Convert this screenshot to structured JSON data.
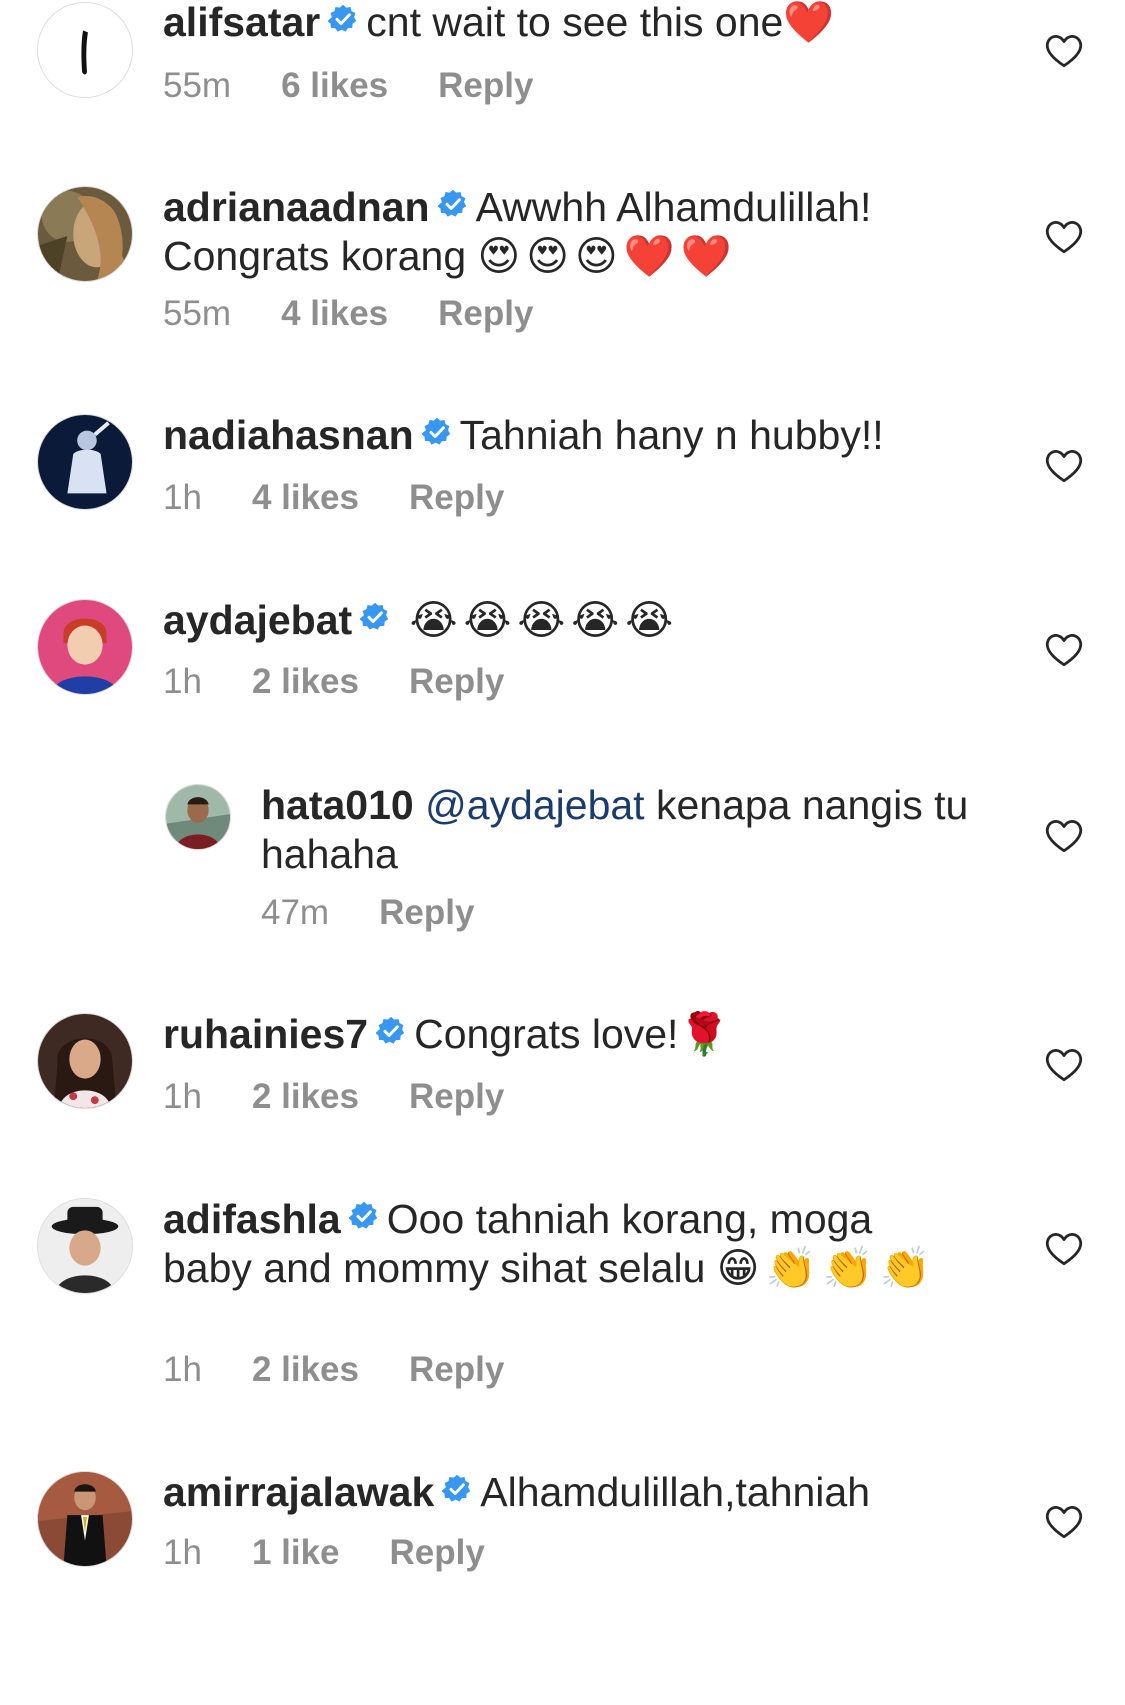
{
  "comments": [
    {
      "username": "alifsatar",
      "text": "cnt wait to see this one",
      "emoji": "❤️",
      "time": "55m",
      "likes": "6 likes",
      "reply": "Reply"
    },
    {
      "username": "adrianaadnan",
      "text": "Awwhh Alhamdulillah! Congrats korang",
      "emoji": "😍😍😍❤️❤️",
      "time": "55m",
      "likes": "4 likes",
      "reply": "Reply"
    },
    {
      "username": "nadiahasnan",
      "text": "Tahniah hany n hubby!!",
      "emoji": "",
      "time": "1h",
      "likes": "4 likes",
      "reply": "Reply"
    },
    {
      "username": "aydajebat",
      "text": "",
      "emoji": "😭😭😭😭😭",
      "time": "1h",
      "likes": "2 likes",
      "reply": "Reply"
    },
    {
      "username": "hata010",
      "mention": "@aydajebat",
      "text": "kenapa nangis tu hahaha",
      "time": "47m",
      "reply": "Reply"
    },
    {
      "username": "ruhainies7",
      "text": "Congrats love!",
      "emoji": "🌹",
      "time": "1h",
      "likes": "2 likes",
      "reply": "Reply"
    },
    {
      "username": "adifashla",
      "text": "Ooo tahniah korang, moga baby and mommy sihat selalu",
      "emoji": "😁👏👏👏",
      "time": "1h",
      "likes": "2 likes",
      "reply": "Reply"
    },
    {
      "username": "amirrajalawak",
      "text": "Alhamdulillah,tahniah",
      "emoji": "",
      "time": "1h",
      "likes": "1 like",
      "reply": "Reply"
    }
  ],
  "colors": {
    "text": "#262626",
    "muted": "#8e8e8e",
    "verified": "#3897f0",
    "mention": "#1b3b6f"
  },
  "icons": {
    "verified": "verified-badge-icon",
    "like": "heart-outline-icon"
  }
}
